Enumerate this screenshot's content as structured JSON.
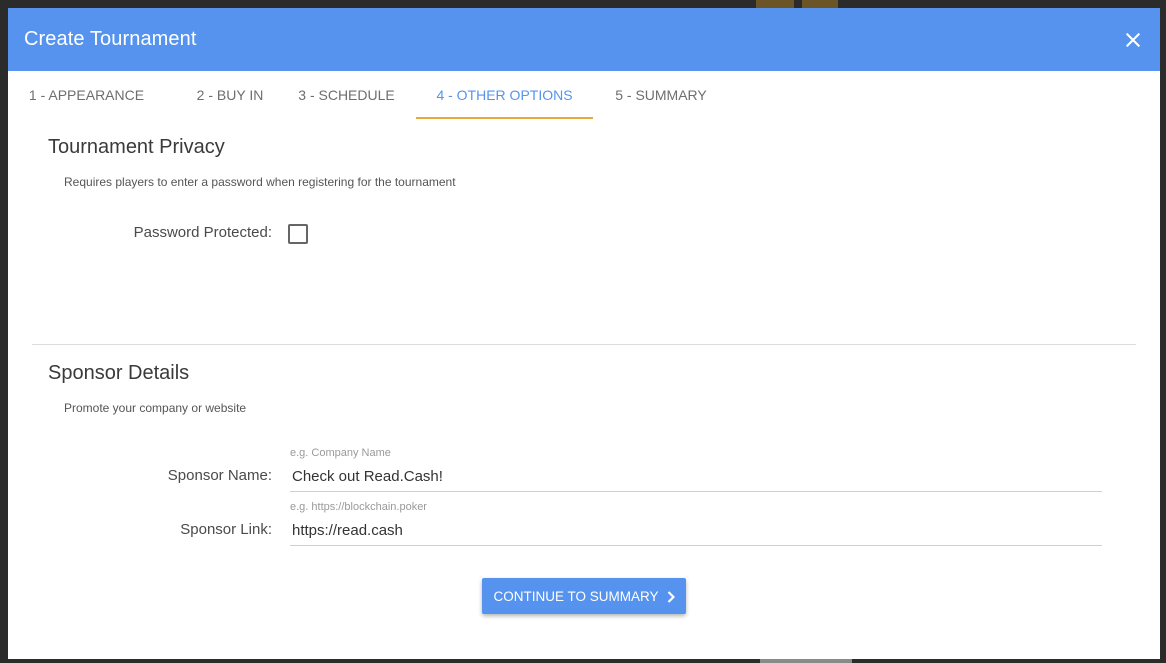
{
  "modal": {
    "title": "Create Tournament",
    "close_icon": "close-icon"
  },
  "tabs": [
    {
      "label": "1 - APPEARANCE"
    },
    {
      "label": "2 - BUY IN"
    },
    {
      "label": "3 - SCHEDULE"
    },
    {
      "label": "4 - OTHER OPTIONS",
      "active": true
    },
    {
      "label": "5 - SUMMARY"
    }
  ],
  "privacy": {
    "title": "Tournament Privacy",
    "description": "Requires players to enter a password when registering for the tournament",
    "password_label": "Password Protected:",
    "password_checked": false
  },
  "sponsor": {
    "title": "Sponsor Details",
    "description": "Promote your company or website",
    "name_label": "Sponsor Name:",
    "name_hint": "e.g. Company Name",
    "name_value": "Check out Read.Cash!",
    "link_label": "Sponsor Link:",
    "link_hint": "e.g. https://blockchain.poker",
    "link_value": "https://read.cash"
  },
  "footer": {
    "continue_label": "CONTINUE TO SUMMARY",
    "continue_icon": "chevron-right-icon"
  },
  "colors": {
    "header": "#5693ee",
    "tab_indicator": "#e6a93a",
    "button": "#5693ee"
  }
}
